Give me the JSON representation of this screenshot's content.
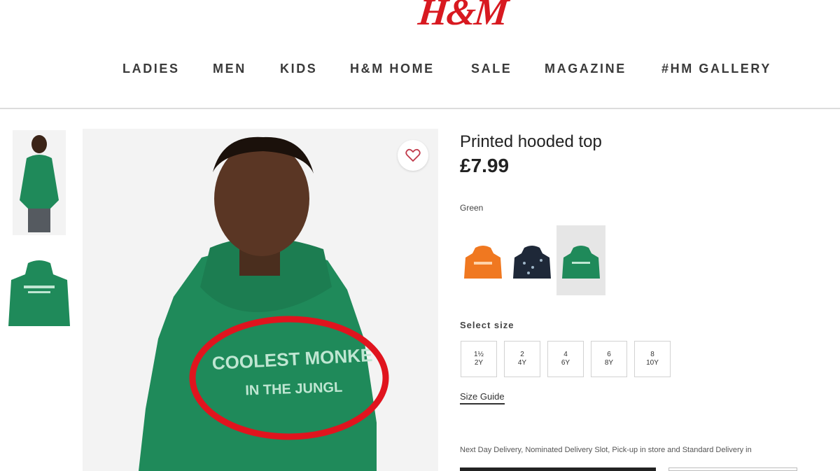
{
  "header": {
    "logo": "H&M",
    "nav": [
      "LADIES",
      "MEN",
      "KIDS",
      "H&M HOME",
      "SALE",
      "MAGAZINE",
      "#HM GALLERY"
    ]
  },
  "product": {
    "title": "Printed hooded top",
    "price": "£7.99",
    "color_label": "Green",
    "print_text": [
      "COOLEST MONKE",
      "IN THE JUNGL"
    ],
    "swatches": [
      {
        "name": "orange",
        "color": "#f07820"
      },
      {
        "name": "navy",
        "color": "#1e2838"
      },
      {
        "name": "green",
        "color": "#1f8a5a",
        "selected": true
      }
    ],
    "size_label": "Select size",
    "sizes": [
      {
        "top": "1½",
        "bottom": "2Y"
      },
      {
        "top": "2",
        "bottom": "4Y"
      },
      {
        "top": "4",
        "bottom": "6Y"
      },
      {
        "top": "6",
        "bottom": "8Y"
      },
      {
        "top": "8",
        "bottom": "10Y"
      }
    ],
    "size_guide": "Size Guide",
    "delivery": "Next Day Delivery, Nominated Delivery Slot, Pick-up in store and Standard Delivery in"
  },
  "colors": {
    "brand": "#d81920",
    "hoodie": "#1f8a5a",
    "annotation": "#e0141e"
  }
}
